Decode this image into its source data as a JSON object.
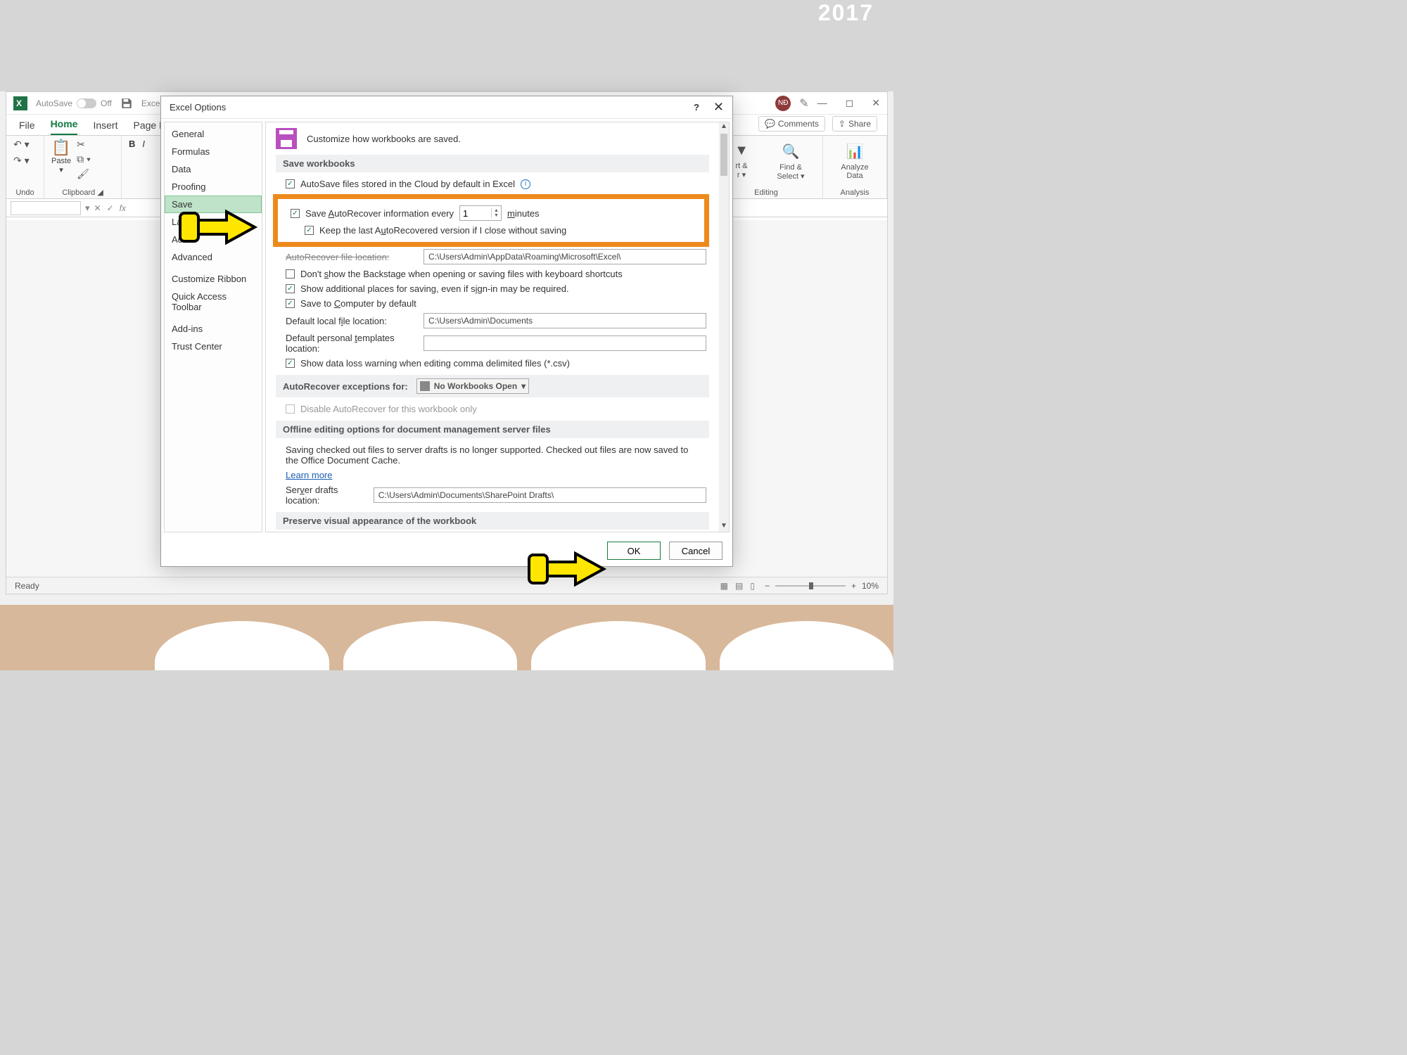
{
  "bg": {
    "year": "2017"
  },
  "excel": {
    "autosave_label": "AutoSave",
    "autosave_state": "Off",
    "doc_hint": "Excel",
    "avatar_initials": "NĐ",
    "tabs": {
      "file": "File",
      "home": "Home",
      "insert": "Insert",
      "pagelayout": "Page Lay"
    },
    "right_buttons": {
      "comments": "Comments",
      "share": "Share"
    },
    "groups": {
      "undo": "Undo",
      "clipboard": "Clipboard",
      "paste": "Paste",
      "editing": "Editing",
      "analysis": "Analysis",
      "sortfilter_a": "rt &",
      "sortfilter_b": "r ▾",
      "findselect": "Find & Select ▾",
      "analyze": "Analyze Data"
    },
    "status": {
      "ready": "Ready",
      "zoom": "10%"
    }
  },
  "dialog": {
    "title": "Excel Options",
    "sidebar": [
      "General",
      "Formulas",
      "Data",
      "Proofing",
      "Save",
      "Lan",
      "Acc",
      "Advanced",
      "Customize Ribbon",
      "Quick Access Toolbar",
      "Add-ins",
      "Trust Center"
    ],
    "header": "Customize how workbooks are saved.",
    "sections": {
      "save_workbooks": "Save workbooks",
      "autorecover_exceptions": "AutoRecover exceptions for:",
      "offline": "Offline editing options for document management server files",
      "preserve": "Preserve visual appearance of the workbook"
    },
    "labels": {
      "autosave_cloud": "AutoSave files stored in the Cloud by default in Excel",
      "save_autorecover": "Save AutoRecover information every",
      "minutes": "minutes",
      "keep_last": "Keep the last AutoRecovered version if I close without saving",
      "autorecover_loc_label": "AutoRecover file location:",
      "autorecover_loc_value": "C:\\Users\\Admin\\AppData\\Roaming\\Microsoft\\Excel\\",
      "dont_show_backstage": "Don't show the Backstage when opening or saving files with keyboard shortcuts",
      "show_additional": "Show additional places for saving, even if sign-in may be required.",
      "save_to_computer": "Save to Computer by default",
      "default_local_label": "Default local file location:",
      "default_local_value": "C:\\Users\\Admin\\Documents",
      "default_templates_label": "Default personal templates location:",
      "default_templates_value": "",
      "show_dataloss": "Show data loss warning when editing comma delimited files (*.csv)",
      "exceptions_combo": "No Workbooks Open",
      "disable_autorecover": "Disable AutoRecover for this workbook only",
      "offline_desc": "Saving checked out files to server drafts is no longer supported. Checked out files are now saved to the Office Document Cache.",
      "learn_more": "Learn more",
      "server_drafts_label": "Server drafts location:",
      "server_drafts_value": "C:\\Users\\Admin\\Documents\\SharePoint Drafts\\"
    },
    "values": {
      "autorecover_minutes": "1"
    },
    "buttons": {
      "ok": "OK",
      "cancel": "Cancel"
    }
  }
}
